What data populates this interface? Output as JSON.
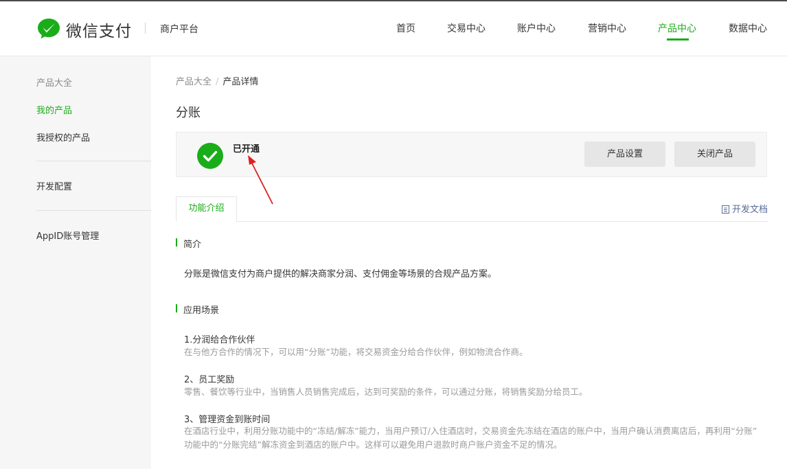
{
  "header": {
    "brand": "微信支付",
    "platform": "商户平台",
    "nav": [
      {
        "label": "首页"
      },
      {
        "label": "交易中心"
      },
      {
        "label": "账户中心"
      },
      {
        "label": "营销中心"
      },
      {
        "label": "产品中心",
        "active": true
      },
      {
        "label": "数据中心"
      }
    ]
  },
  "sidebar": {
    "items": [
      {
        "label": "产品大全"
      },
      {
        "label": "我的产品",
        "active": true
      },
      {
        "label": "我授权的产品"
      },
      {
        "label": "开发配置"
      },
      {
        "label": "AppID账号管理"
      }
    ]
  },
  "breadcrumb": {
    "parent": "产品大全",
    "separator": "/",
    "current": "产品详情"
  },
  "page_title": "分账",
  "status": {
    "text": "已开通",
    "settings_button": "产品设置",
    "close_button": "关闭产品"
  },
  "tabs": {
    "intro": "功能介绍",
    "doc_link": "开发文档"
  },
  "intro": {
    "title": "简介",
    "text": "分账是微信支付为商户提供的解决商家分润、支付佣金等场景的合规产品方案。"
  },
  "scenarios": {
    "title": "应用场景",
    "items": [
      {
        "title": "1.分润给合作伙伴",
        "desc": [
          "在与他方合作的情况下，可以用“分账”功能，将交易资金分给合作伙伴，例如物流合作商。"
        ]
      },
      {
        "title": "2、员工奖励",
        "desc": [
          "零售、餐饮等行业中，当销售人员销售完成后，达到可奖励的条件，可以通过分账，将销售奖励分给员工。"
        ]
      },
      {
        "title": "3、管理资金到账时间",
        "desc": [
          "在酒店行业中，利用分账功能中的“冻结/解冻”能力，当用户预订/入住酒店时，交易资金先冻结在酒店的账户中，当用户确认消费离店后，再利用“分账”",
          "功能中的“分账完结”解冻资金到酒店的账户中。这样可以避免用户退款时商户账户资金不足的情况。"
        ]
      }
    ]
  },
  "colors": {
    "accent": "#1aad19",
    "link": "#576b95",
    "arrow": "#e02020"
  }
}
